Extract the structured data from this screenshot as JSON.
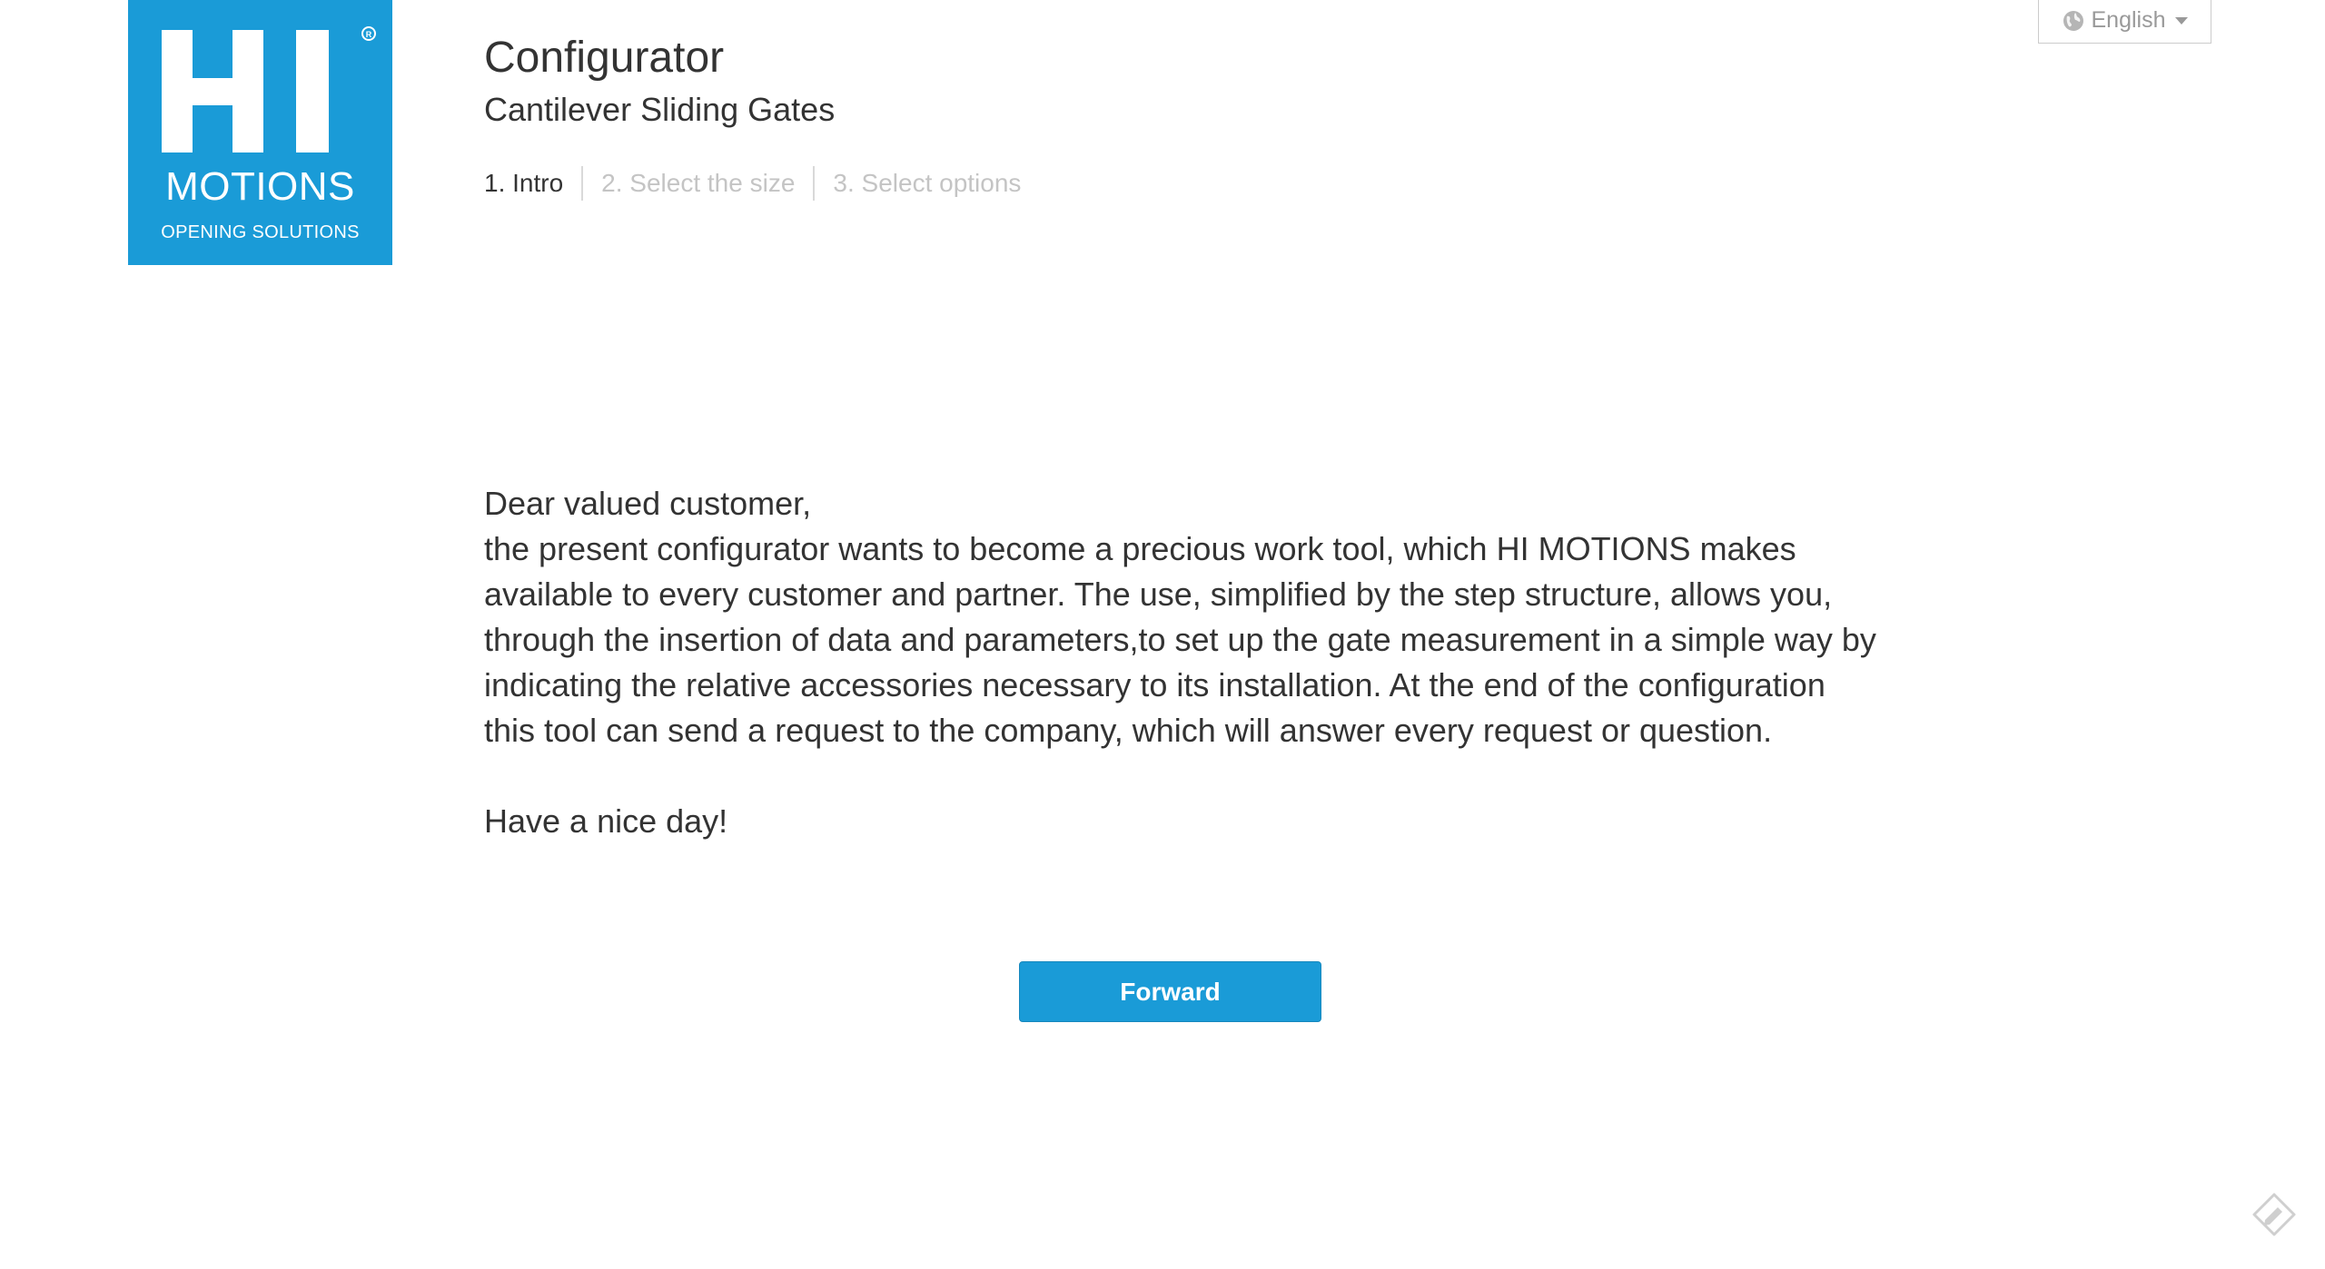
{
  "logo": {
    "mark": "HI",
    "brand": "MOTIONS",
    "tagline": "OPENING SOLUTIONS",
    "registered": "®",
    "color": "#1a9bd7"
  },
  "header": {
    "title": "Configurator",
    "subtitle": "Cantilever Sliding Gates"
  },
  "steps": [
    {
      "label": "1. Intro",
      "active": true
    },
    {
      "label": "2. Select the size",
      "active": false
    },
    {
      "label": "3. Select options",
      "active": false
    }
  ],
  "language": {
    "selected": "English",
    "icon": "globe-icon"
  },
  "content": {
    "greeting": "Dear valued customer,",
    "body": "the present configurator wants to become a precious work tool, which HI MOTIONS makes available to every customer and partner. The use, simplified by the step structure, allows you, through the insertion of data and parameters,to set up the gate measurement in a simple way by indicating the relative accessories necessary to its installation. At the end of the configuration this tool can send a request to the company, which will answer every request or question.",
    "closing": "Have a nice day!"
  },
  "actions": {
    "forward_label": "Forward",
    "accent": "#1a9bd7"
  },
  "corner": {
    "icon": "edit-icon"
  }
}
